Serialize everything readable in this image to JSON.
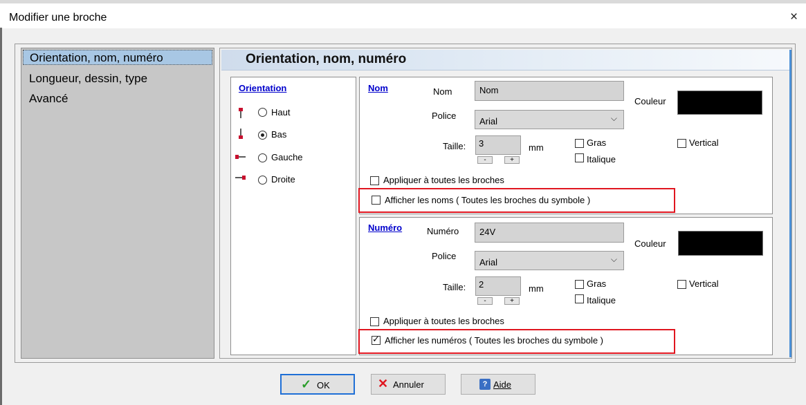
{
  "window": {
    "title": "Modifier une broche",
    "close_glyph": "×"
  },
  "nav": {
    "items": [
      {
        "label": "Orientation, nom, numéro",
        "selected": true
      },
      {
        "label": "Longueur, dessin, type",
        "selected": false
      },
      {
        "label": "Avancé",
        "selected": false
      }
    ]
  },
  "content": {
    "header": "Orientation, nom, numéro"
  },
  "orientation": {
    "title": "Orientation",
    "options": [
      {
        "label": "Haut",
        "checked": false,
        "icon": "pin-up-icon"
      },
      {
        "label": "Bas",
        "checked": true,
        "icon": "pin-down-icon"
      },
      {
        "label": "Gauche",
        "checked": false,
        "icon": "pin-left-icon"
      },
      {
        "label": "Droite",
        "checked": false,
        "icon": "pin-right-icon"
      }
    ]
  },
  "nom": {
    "title": "Nom",
    "field_label": "Nom",
    "value": "Nom",
    "font_label": "Police",
    "font_value": "Arial",
    "size_label": "Taille:",
    "size_value": "3",
    "unit": "mm",
    "spin_minus": "-",
    "spin_plus": "+",
    "bold_label": "Gras",
    "italic_label": "Italique",
    "vertical_label": "Vertical",
    "color_label": "Couleur",
    "color": "#000000",
    "apply_all_label": "Appliquer à toutes les broches",
    "show_label": "Afficher les noms ( Toutes les broches du symbole )",
    "show_checked": false
  },
  "numero": {
    "title": "Numéro",
    "field_label": "Numéro",
    "value": "24V",
    "font_label": "Police",
    "font_value": "Arial",
    "size_label": "Taille:",
    "size_value": "2",
    "unit": "mm",
    "spin_minus": "-",
    "spin_plus": "+",
    "bold_label": "Gras",
    "italic_label": "Italique",
    "vertical_label": "Vertical",
    "color_label": "Couleur",
    "color": "#000000",
    "apply_all_label": "Appliquer à toutes les broches",
    "show_label": "Afficher les numéros ( Toutes les broches du symbole )",
    "show_checked": true
  },
  "buttons": {
    "ok": "OK",
    "cancel": "Annuler",
    "help": "Aide"
  },
  "colors": {
    "highlight_red": "#e0151f",
    "pin_icon_red": "#c8102e",
    "nav_selected": "#a8c7e4",
    "link_blue": "#0000cc"
  }
}
